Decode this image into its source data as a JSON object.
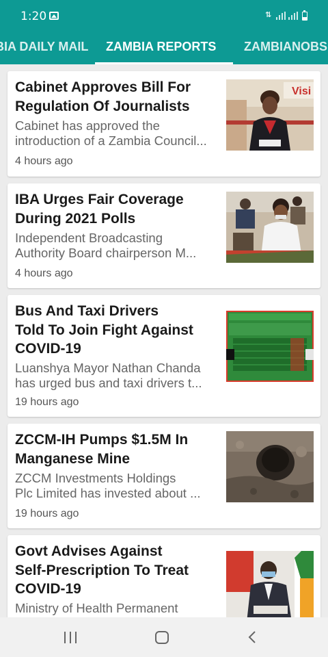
{
  "status_bar": {
    "time": "1:20",
    "icons": [
      "gallery-icon",
      "4g-signal-icon",
      "signal-bars-icon",
      "signal-bars-icon",
      "battery-icon"
    ]
  },
  "tabs": [
    {
      "label": "ZAMBIA DAILY MAIL",
      "active": false
    },
    {
      "label": "ZAMBIA REPORTS",
      "active": true
    },
    {
      "label": "ZAMBIANOBSERVER",
      "active": false
    }
  ],
  "articles": [
    {
      "title_lines": [
        "Cabinet Approves Bill For",
        "Regulation Of Journalists"
      ],
      "excerpt_lines": [
        "Cabinet has approved the",
        "introduction of a Zambia Council..."
      ],
      "time": "4 hours ago",
      "thumbnail": "woman-at-press-briefing-photo"
    },
    {
      "title_lines": [
        "IBA Urges Fair Coverage",
        "During 2021 Polls"
      ],
      "excerpt_lines": [
        "Independent Broadcasting",
        "Authority Board chairperson M..."
      ],
      "time": "4 hours ago",
      "thumbnail": "woman-speaking-at-event-photo"
    },
    {
      "title_lines": [
        "Bus And Taxi Drivers",
        "Told To Join Fight Against",
        "COVID-19"
      ],
      "excerpt_lines": [
        "Luanshya Mayor Nathan Chanda",
        "has urged bus and taxi drivers t..."
      ],
      "time": "19 hours ago",
      "thumbnail": "covid-status-update-infographic"
    },
    {
      "title_lines": [
        "ZCCM-IH Pumps $1.5M In",
        "Manganese Mine"
      ],
      "excerpt_lines": [
        "ZCCM Investments Holdings",
        "Plc Limited has invested about ..."
      ],
      "time": "19 hours ago",
      "thumbnail": "mine-tunnel-photo"
    },
    {
      "title_lines": [
        "Govt Advises Against",
        "Self-Prescription To Treat",
        "COVID-19"
      ],
      "excerpt_lines": [
        "Ministry of Health Permanent"
      ],
      "time": "",
      "thumbnail": "official-signing-document-photo"
    }
  ],
  "nav_bar": {
    "buttons": [
      "recent-apps-icon",
      "home-icon",
      "back-icon"
    ]
  },
  "colors": {
    "header": "#0d9a94",
    "background": "#ececec",
    "card": "#ffffff",
    "title": "#1a1a1a",
    "excerpt": "#666666"
  }
}
